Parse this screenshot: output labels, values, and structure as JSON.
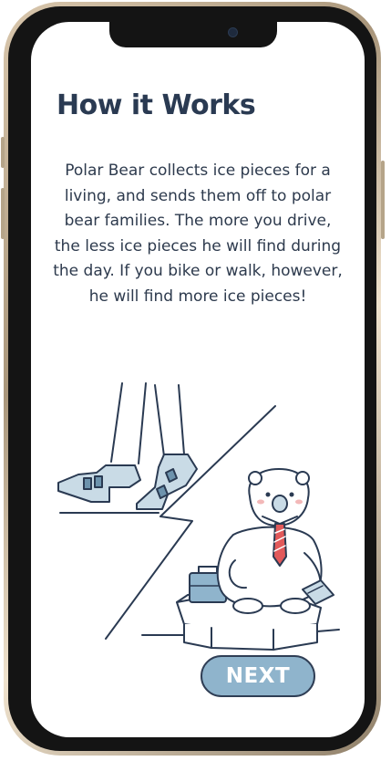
{
  "onboarding": {
    "title": "How it Works",
    "description": "Polar Bear collects ice pieces for a living, and sends them off to polar bear families. The more you drive, the less ice pieces he will find during the day. If you bike or walk, however, he will find more ice pieces!",
    "next_label": "NEXT"
  },
  "illustration": {
    "name": "polar-bear-and-walking-feet",
    "icons": [
      "walking-feet-icon",
      "polar-bear-icon",
      "briefcase-icon",
      "ice-block-icon",
      "book-icon"
    ]
  },
  "colors": {
    "title": "#2a3a52",
    "text": "#2d3a4d",
    "accent": "#8fb4cc",
    "ice": "#c9dbe6",
    "tie": "#e2595a",
    "button_border": "#2f3e55",
    "frame": "#141414"
  }
}
